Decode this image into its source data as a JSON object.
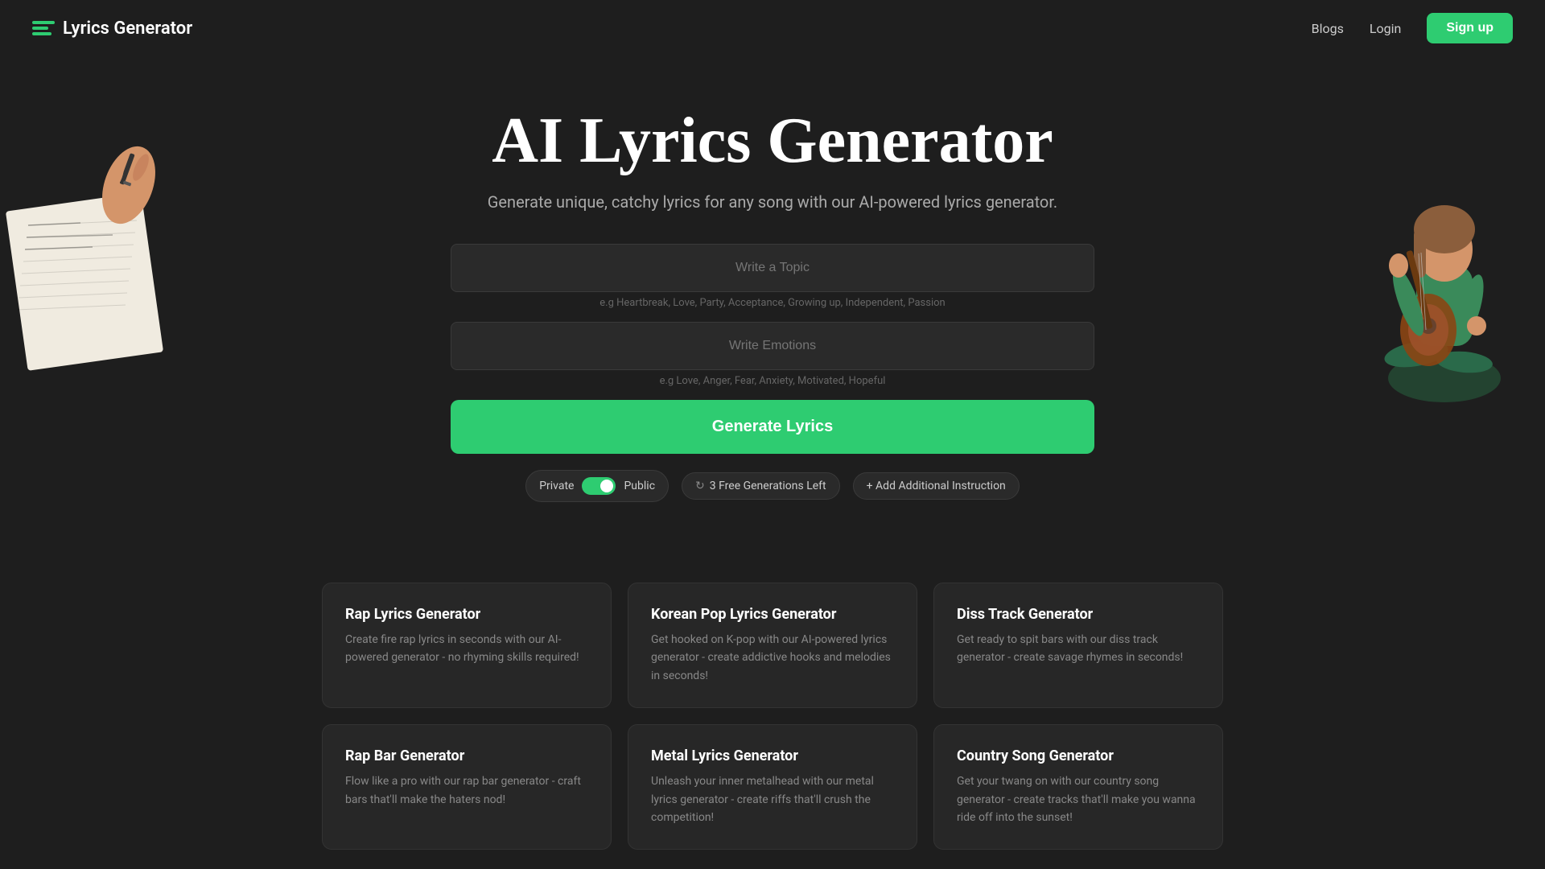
{
  "nav": {
    "logo_text": "Lyrics Generator",
    "links": [
      {
        "label": "Blogs",
        "id": "blogs"
      },
      {
        "label": "Login",
        "id": "login"
      }
    ],
    "signup_label": "Sign up"
  },
  "hero": {
    "title": "AI Lyrics Generator",
    "subtitle": "Generate unique, catchy lyrics for any song with our AI-powered lyrics generator."
  },
  "form": {
    "topic_placeholder": "Write a Topic",
    "topic_hint": "e.g Heartbreak, Love, Party, Acceptance, Growing up, Independent, Passion",
    "emotions_placeholder": "Write Emotions",
    "emotions_hint": "e.g Love, Anger, Fear, Anxiety, Motivated, Hopeful",
    "generate_label": "Generate Lyrics"
  },
  "controls": {
    "private_label": "Private",
    "public_label": "Public",
    "generations_label": "3 Free Generations Left",
    "add_instruction_label": "+ Add Additional Instruction"
  },
  "cards": [
    {
      "title": "Rap Lyrics Generator",
      "desc": "Create fire rap lyrics in seconds with our AI-powered generator - no rhyming skills required!"
    },
    {
      "title": "Korean Pop Lyrics Generator",
      "desc": "Get hooked on K-pop with our AI-powered lyrics generator - create addictive hooks and melodies in seconds!"
    },
    {
      "title": "Diss Track Generator",
      "desc": "Get ready to spit bars with our diss track generator - create savage rhymes in seconds!"
    },
    {
      "title": "Rap Bar Generator",
      "desc": "Flow like a pro with our rap bar generator - craft bars that'll make the haters nod!"
    },
    {
      "title": "Metal Lyrics Generator",
      "desc": "Unleash your inner metalhead with our metal lyrics generator - create riffs that'll crush the competition!"
    },
    {
      "title": "Country Song Generator",
      "desc": "Get your twang on with our country song generator - create tracks that'll make you wanna ride off into the sunset!"
    }
  ]
}
